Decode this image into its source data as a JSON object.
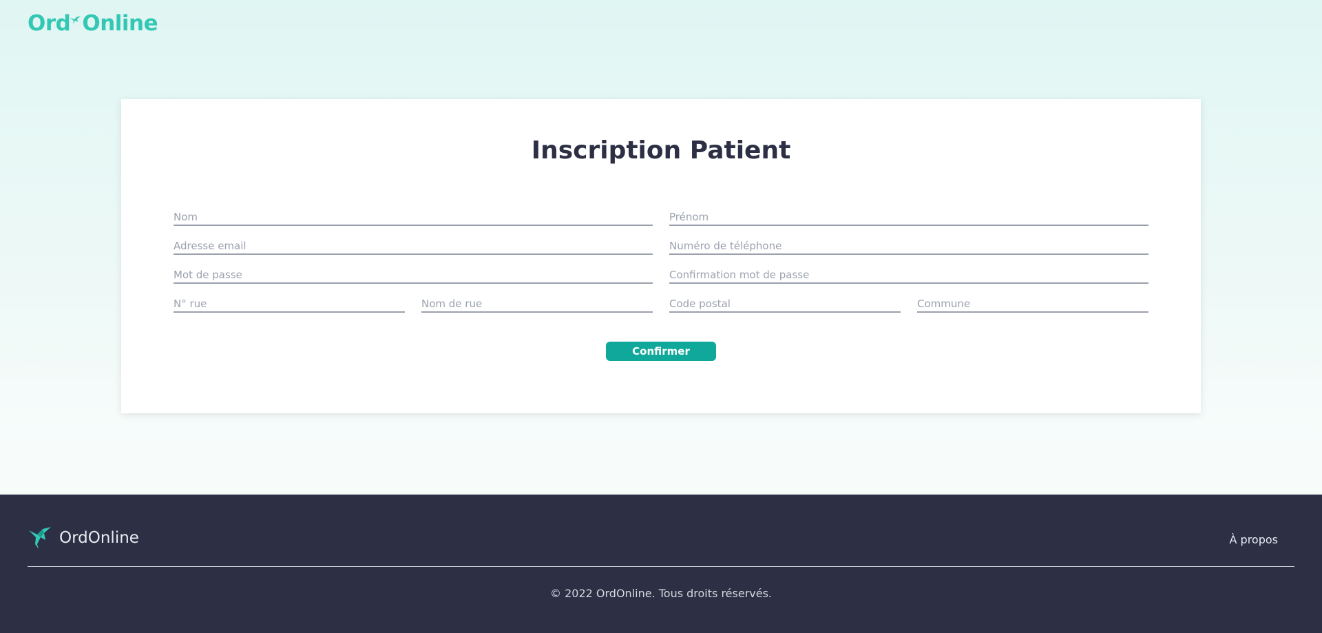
{
  "header": {
    "logo_text_left": "Ord",
    "logo_text_right": "Online"
  },
  "form": {
    "title": "Inscription Patient",
    "fields": {
      "nom": "Nom",
      "prenom": "Prénom",
      "email": "Adresse email",
      "telephone": "Numéro de téléphone",
      "password": "Mot de passe",
      "password_confirm": "Confirmation mot de passe",
      "street_number": "N° rue",
      "street_name": "Nom de rue",
      "postal_code": "Code postal",
      "city": "Commune"
    },
    "submit_label": "Confirmer"
  },
  "footer": {
    "brand": "OrdOnline",
    "about_link": "À propos",
    "copyright": "© 2022 OrdOnline. Tous droits réservés."
  },
  "colors": {
    "brand_teal": "#34c8b4",
    "button": "#0fa89a",
    "footer_bg": "#2d2f45"
  },
  "icons": {
    "logo": "hummingbird-icon"
  }
}
